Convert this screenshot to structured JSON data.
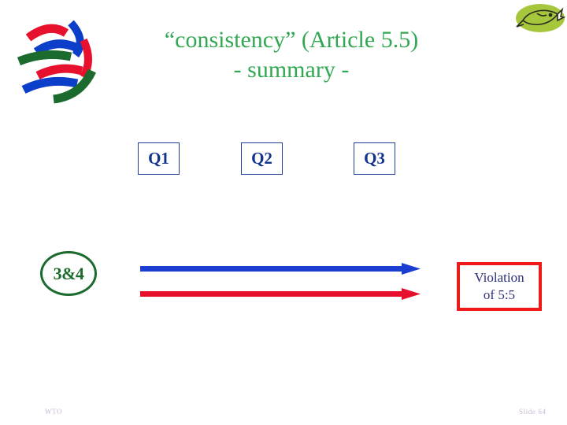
{
  "slide": {
    "background_color": "#ffffff",
    "title": {
      "line1": "“consistency” (Article 5.5)",
      "line2": "- summary -",
      "color": "#33a852"
    },
    "logo": {
      "name": "wto-globe-logo",
      "colors": {
        "red": "#e8112d",
        "blue": "#0b3ec9",
        "green": "#1b6b2e"
      }
    },
    "emblem": {
      "name": "fish-emblem",
      "ellipse_color": "#a6c63c",
      "fish_color": "#2b2b1f"
    },
    "question_boxes": [
      {
        "label": "Q1",
        "name": "qbox-q1"
      },
      {
        "label": "Q2",
        "name": "qbox-q2"
      },
      {
        "label": "Q3",
        "name": "qbox-q3"
      }
    ],
    "question_box_style": {
      "border_color": "#1f3f9e",
      "text_color": "#11348f"
    },
    "oval_marker": {
      "label": "3&4",
      "color": "#1b6b2e"
    },
    "arrows": [
      {
        "name": "arrow-blue",
        "color": "#1a3fd0",
        "direction": "right"
      },
      {
        "name": "arrow-red",
        "color": "#e8112d",
        "direction": "right"
      }
    ],
    "violation_box": {
      "line1": "Violation",
      "line2": "of 5:5",
      "border_color": "#ef1a1a",
      "text_color": "#2b2f78"
    },
    "footer": {
      "left_label": "WTO",
      "right_label": "Slide 64",
      "color": "#c7b9d6"
    }
  }
}
